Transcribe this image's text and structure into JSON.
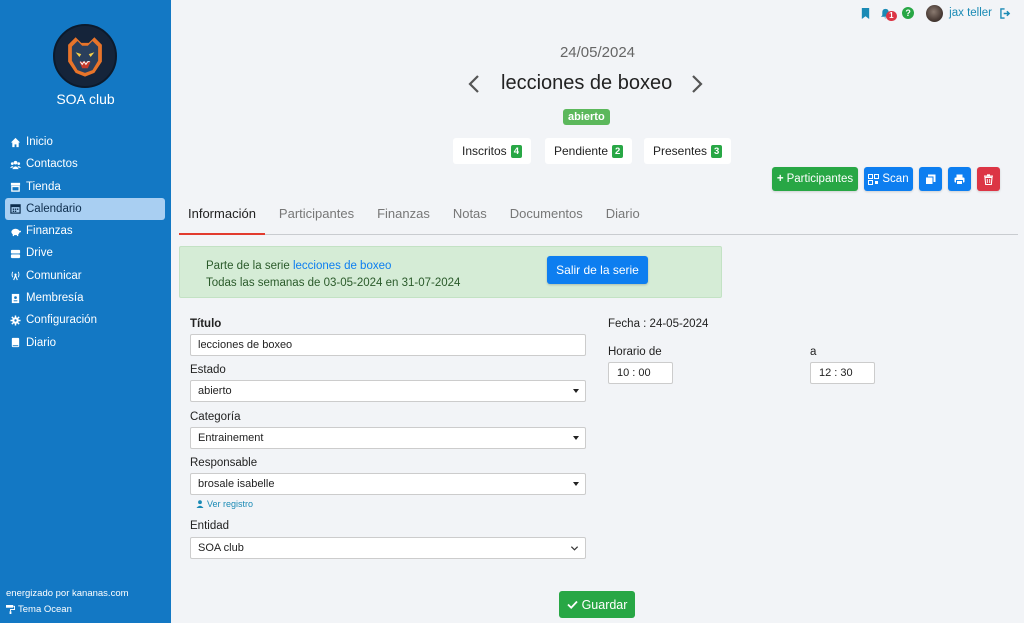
{
  "sidebar": {
    "club_name": "SOA club",
    "items": [
      {
        "label": "Inicio",
        "icon": "home-icon"
      },
      {
        "label": "Contactos",
        "icon": "users-icon"
      },
      {
        "label": "Tienda",
        "icon": "store-icon"
      },
      {
        "label": "Calendario",
        "icon": "calendar-icon",
        "active": true
      },
      {
        "label": "Finanzas",
        "icon": "piggy-bank-icon"
      },
      {
        "label": "Drive",
        "icon": "hard-drive-icon"
      },
      {
        "label": "Comunicar",
        "icon": "broadcast-icon"
      },
      {
        "label": "Membresía",
        "icon": "id-card-icon"
      },
      {
        "label": "Configuración",
        "icon": "gear-icon"
      },
      {
        "label": "Diario",
        "icon": "book-icon"
      }
    ],
    "powered_by": "energizado por kananas.com",
    "theme": "Tema Ocean"
  },
  "topbar": {
    "notification_count": "1",
    "help": "?",
    "user_name": "jax teller"
  },
  "header": {
    "date": "24/05/2024",
    "title": "lecciones de boxeo",
    "status": "abierto"
  },
  "counters": [
    {
      "label": "Inscritos",
      "count": "4"
    },
    {
      "label": "Pendiente",
      "count": "2"
    },
    {
      "label": "Presentes",
      "count": "3"
    }
  ],
  "actions": {
    "participants": "Participantes",
    "scan": "Scan"
  },
  "tabs": [
    "Información",
    "Participantes",
    "Finanzas",
    "Notas",
    "Documentos",
    "Diario"
  ],
  "series": {
    "prefix": "Parte de la serie ",
    "link": "lecciones de boxeo",
    "schedule": "Todas las semanas de 03-05-2024 en 31-07-2024",
    "leave_button": "Salir de la serie"
  },
  "form": {
    "title_label": "Título",
    "title_value": "lecciones de boxeo",
    "state_label": "Estado",
    "state_value": "abierto",
    "category_label": "Categoría",
    "category_value": "Entrainement",
    "responsible_label": "Responsable",
    "responsible_value": "brosale isabelle",
    "view_record": "Ver registro",
    "entity_label": "Entidad",
    "entity_value": "SOA club",
    "date_text": "Fecha : 24-05-2024",
    "time_from_label": "Horario de",
    "time_from": "10 : 00",
    "time_to_label": "a",
    "time_to": "12 : 30",
    "save": "Guardar"
  },
  "colors": {
    "sidebar": "#1378c4",
    "primary": "#0d7ef0",
    "success": "#28a745",
    "danger": "#dc3545",
    "tab_accent": "#e23b2e"
  }
}
